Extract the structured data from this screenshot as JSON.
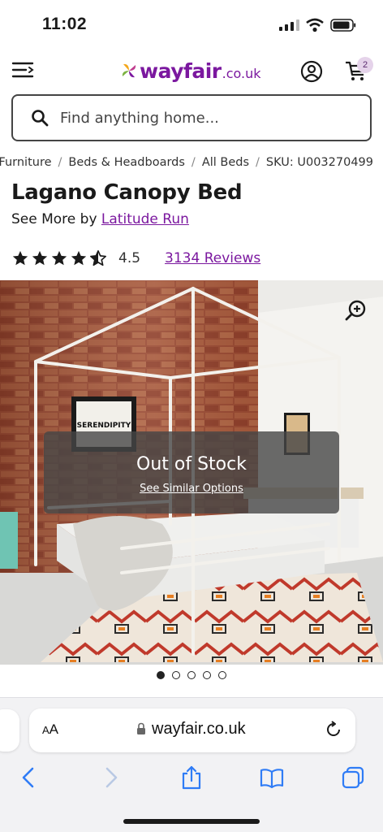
{
  "status_bar": {
    "time": "11:02"
  },
  "header": {
    "logo_word": "wayfair",
    "logo_tld": ".co.uk",
    "cart_count": "2"
  },
  "search": {
    "placeholder": "Find anything home..."
  },
  "breadcrumb": {
    "items": [
      "Furniture",
      "Beds & Headboards",
      "All Beds",
      "SKU: U003270499"
    ],
    "separator": "/"
  },
  "product": {
    "title": "Lagano Canopy Bed",
    "see_more_prefix": "See More by",
    "brand": "Latitude Run",
    "rating": "4.5",
    "rating_value": 4.5,
    "rating_max": 5,
    "reviews_label": "3134 Reviews"
  },
  "image": {
    "wall_sign": "SERENDIPITY",
    "stock_status": "Out of Stock",
    "similar_link": "See Similar Options",
    "slide_count": 5,
    "active_slide": 1
  },
  "browser": {
    "aa_label_big": "A",
    "aa_label_small": "A",
    "url": "wayfair.co.uk"
  },
  "colors": {
    "brand": "#7b189f",
    "toolbar_blue": "#2f7cf6"
  }
}
